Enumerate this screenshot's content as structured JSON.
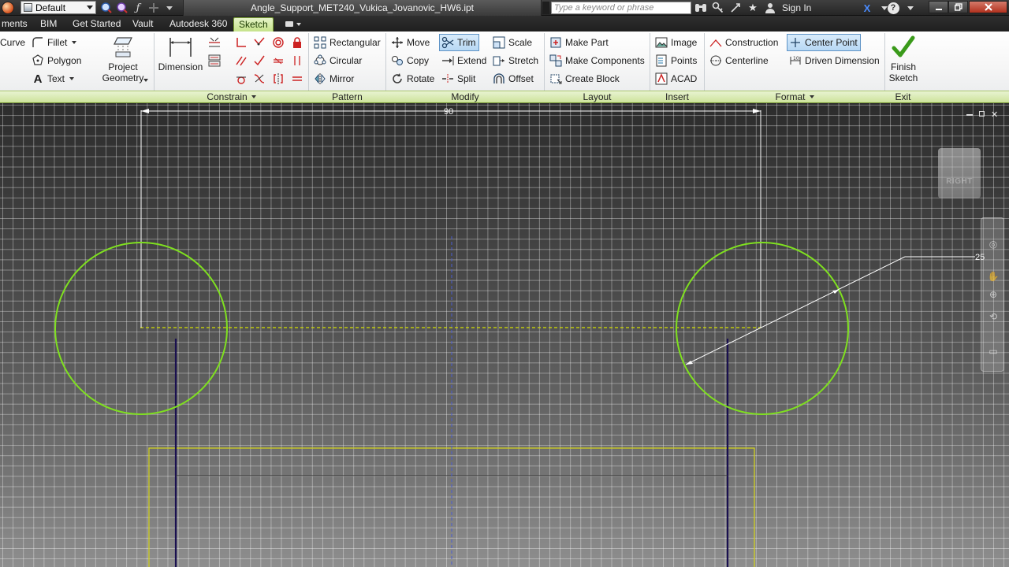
{
  "titlebar": {
    "style_value": "Default",
    "document_title": "Angle_Support_MET240_Vukica_Jovanovic_HW6.ipt",
    "search_placeholder": "Type a keyword or phrase",
    "signin_label": "Sign In",
    "help_label": "?"
  },
  "tabs": [
    {
      "label": "ments"
    },
    {
      "label": "BIM"
    },
    {
      "label": "Get Started"
    },
    {
      "label": "Vault"
    },
    {
      "label": "Autodesk 360"
    },
    {
      "label": "Sketch"
    }
  ],
  "ribbon": {
    "create": {
      "curve": "Curve",
      "fillet": "Fillet",
      "polygon": "Polygon",
      "text": "Text",
      "project_geometry_line1": "Project",
      "project_geometry_line2": "Geometry"
    },
    "constrain": {
      "dimension": "Dimension",
      "panel_label": "Constrain"
    },
    "pattern": {
      "rectangular": "Rectangular",
      "circular": "Circular",
      "mirror": "Mirror",
      "panel_label": "Pattern"
    },
    "modify": {
      "move": "Move",
      "copy": "Copy",
      "rotate": "Rotate",
      "trim": "Trim",
      "extend": "Extend",
      "split": "Split",
      "scale": "Scale",
      "stretch": "Stretch",
      "offset": "Offset",
      "panel_label": "Modify"
    },
    "layout": {
      "make_part": "Make Part",
      "make_components": "Make Components",
      "create_block": "Create Block",
      "panel_label": "Layout"
    },
    "insert": {
      "image": "Image",
      "points": "Points",
      "acad": "ACAD",
      "panel_label": "Insert"
    },
    "format": {
      "construction": "Construction",
      "center_point": "Center Point",
      "centerline": "Centerline",
      "driven_dimension": "Driven Dimension",
      "panel_label": "Format"
    },
    "exit": {
      "finish_line1": "Finish",
      "finish_line2": "Sketch",
      "panel_label": "Exit"
    }
  },
  "canvas": {
    "dim_width": "90",
    "dim_diameter": "25",
    "viewcube_label": "RIGHT"
  },
  "colors": {
    "sketch_circle": "#7fe01f",
    "construction_line": "#d4e000",
    "profile_yellow": "#d0d020",
    "dark_line": "#1a1050",
    "active_tab": "#c5e38a"
  }
}
